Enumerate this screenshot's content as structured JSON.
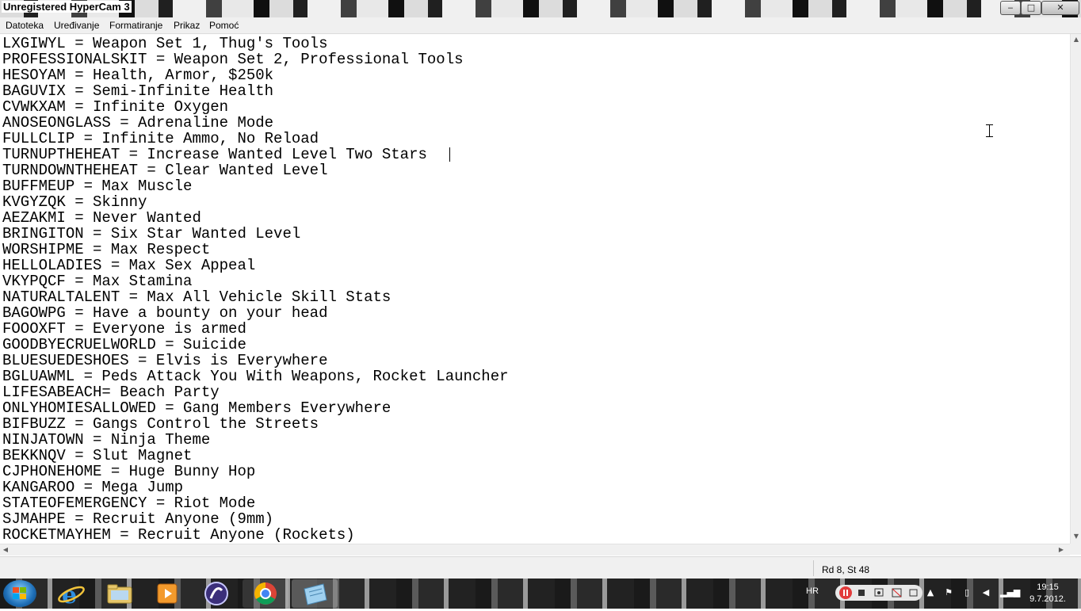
{
  "window": {
    "title": "Unregistered HyperCam 3",
    "controls": {
      "minimize": "‒",
      "maximize": "□",
      "close": "✕"
    }
  },
  "menu": [
    "Datoteka",
    "Uređivanje",
    "Formatiranje",
    "Prikaz",
    "Pomoć"
  ],
  "document": {
    "lines": [
      "LXGIWYL = Weapon Set 1, Thug's Tools",
      "PROFESSIONALSKIT = Weapon Set 2, Professional Tools",
      "HESOYAM = Health, Armor, $250k",
      "BAGUVIX = Semi-Infinite Health",
      "CVWKXAM = Infinite Oxygen",
      "ANOSEONGLASS = Adrenaline Mode",
      "FULLCLIP = Infinite Ammo, No Reload",
      "TURNUPTHEHEAT = Increase Wanted Level Two Stars",
      "TURNDOWNTHEHEAT = Clear Wanted Level",
      "BUFFMEUP = Max Muscle",
      "KVGYZQK = Skinny",
      "AEZAKMI = Never Wanted",
      "BRINGITON = Six Star Wanted Level",
      "WORSHIPME = Max Respect",
      "HELLOLADIES = Max Sex Appeal",
      "VKYPQCF = Max Stamina",
      "NATURALTALENT = Max All Vehicle Skill Stats",
      "BAGOWPG = Have a bounty on your head",
      "FOOOXFT = Everyone is armed",
      "GOODBYECRUELWORLD = Suicide",
      "BLUESUEDESHOES = Elvis is Everywhere",
      "BGLUAWML = Peds Attack You With Weapons, Rocket Launcher",
      "LIFESABEACH= Beach Party",
      "ONLYHOMIESALLOWED = Gang Members Everywhere",
      "BIFBUZZ = Gangs Control the Streets",
      "NINJATOWN = Ninja Theme",
      "BEKKNQV = Slut Magnet",
      "CJPHONEHOME = Huge Bunny Hop",
      "KANGAROO = Mega Jump",
      "STATEOFEMERGENCY = Riot Mode",
      "SJMAHPE = Recruit Anyone (9mm)",
      "ROCKETMAYHEM = Recruit Anyone (Rockets)"
    ]
  },
  "statusbar": {
    "position": "Rd 8, St 48"
  },
  "taskbar": {
    "apps": [
      "start-orb",
      "internet-explorer-icon",
      "file-explorer-icon",
      "media-player-icon",
      "torrent-client-icon",
      "chrome-icon",
      "notepad-icon"
    ],
    "language": "HR",
    "clock_time": "19:15",
    "clock_date": "9.7.2012."
  },
  "colors": {
    "accent": "#1e6fb8",
    "menu_bg": "#f0f0f0",
    "text": "#000000"
  }
}
